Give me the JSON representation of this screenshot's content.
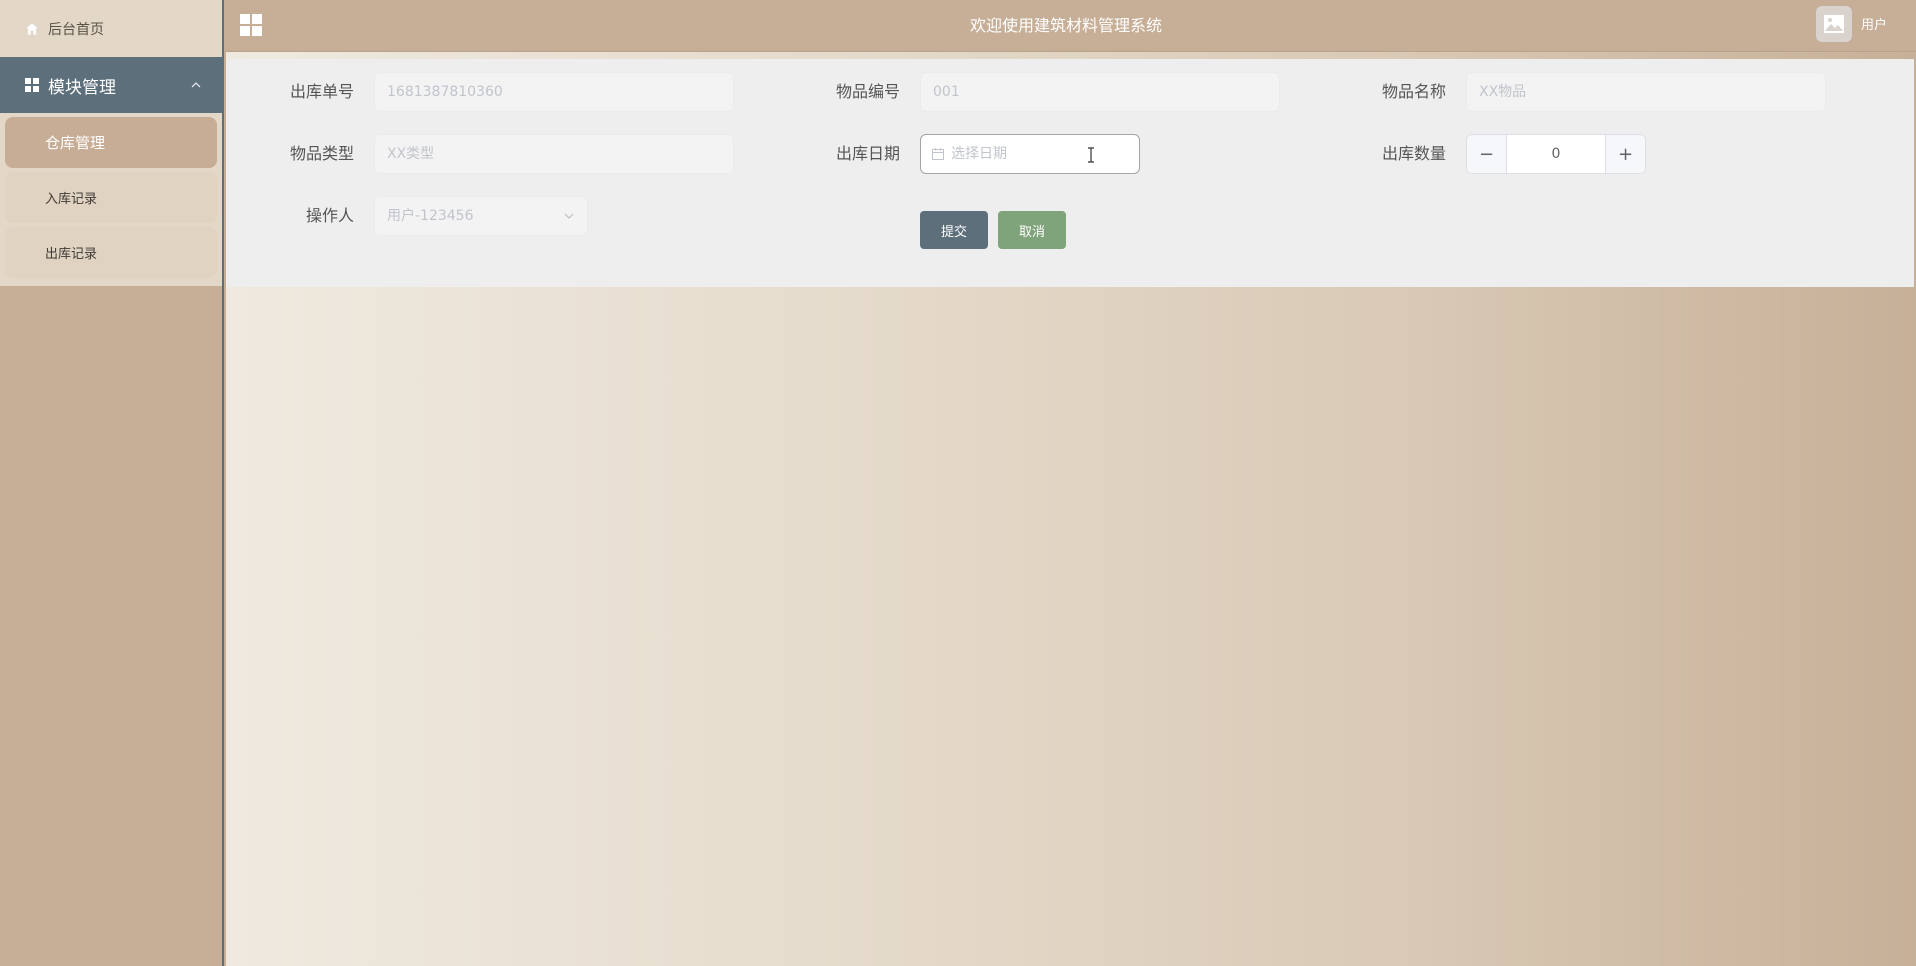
{
  "sidebar": {
    "home_label": "后台首页",
    "module_label": "模块管理",
    "items": [
      {
        "label": "仓库管理"
      },
      {
        "label": "入库记录"
      },
      {
        "label": "出库记录"
      }
    ]
  },
  "header": {
    "title": "欢迎使用建筑材料管理系统",
    "user_label": "用户"
  },
  "form": {
    "order_no": {
      "label": "出库单号",
      "placeholder": "1681387810360"
    },
    "item_code": {
      "label": "物品编号",
      "placeholder": "001"
    },
    "item_name": {
      "label": "物品名称",
      "placeholder": "XX物品"
    },
    "item_type": {
      "label": "物品类型",
      "placeholder": "XX类型"
    },
    "out_date": {
      "label": "出库日期",
      "placeholder": "选择日期"
    },
    "quantity": {
      "label": "出库数量",
      "value": "0",
      "minus": "−",
      "plus": "+"
    },
    "operator": {
      "label": "操作人",
      "value": "用户-123456"
    },
    "submit_label": "提交",
    "cancel_label": "取消"
  },
  "colors": {
    "sidebar_bg": "#c6ae97",
    "module_bg": "#5d6f7b",
    "active_item_bg": "#c7ad95",
    "submit_bg": "#5d6f7b",
    "cancel_bg": "#7fa37b"
  }
}
